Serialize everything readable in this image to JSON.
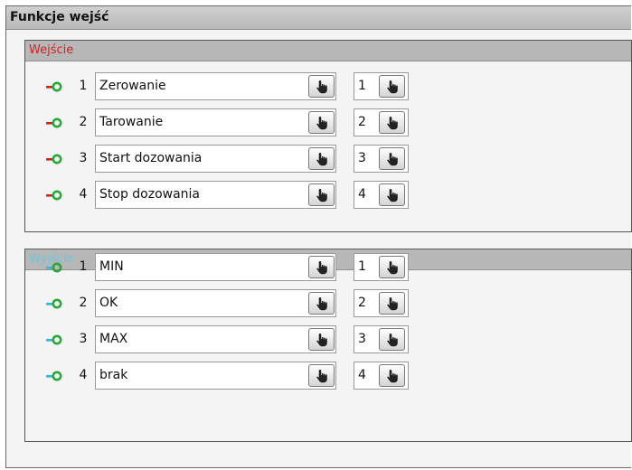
{
  "window": {
    "title": "Funkcje wejść"
  },
  "inputs": {
    "title": "Wejście",
    "title_color": "#d42020",
    "icon": "input-connector-icon",
    "rows": [
      {
        "num": "1",
        "function": "Zerowanie",
        "value": "1"
      },
      {
        "num": "2",
        "function": "Tarowanie",
        "value": "2"
      },
      {
        "num": "3",
        "function": "Start dozowania",
        "value": "3"
      },
      {
        "num": "4",
        "function": "Stop dozowania",
        "value": "4"
      }
    ]
  },
  "outputs": {
    "title": "Wyjście",
    "title_color": "#6ec7de",
    "icon": "output-connector-icon",
    "rows": [
      {
        "num": "1",
        "function": "MIN",
        "value": "1"
      },
      {
        "num": "2",
        "function": "OK",
        "value": "2"
      },
      {
        "num": "3",
        "function": "MAX",
        "value": "3"
      },
      {
        "num": "4",
        "function": "brak",
        "value": "4"
      }
    ]
  },
  "button_icon": "hand-pointer-icon"
}
